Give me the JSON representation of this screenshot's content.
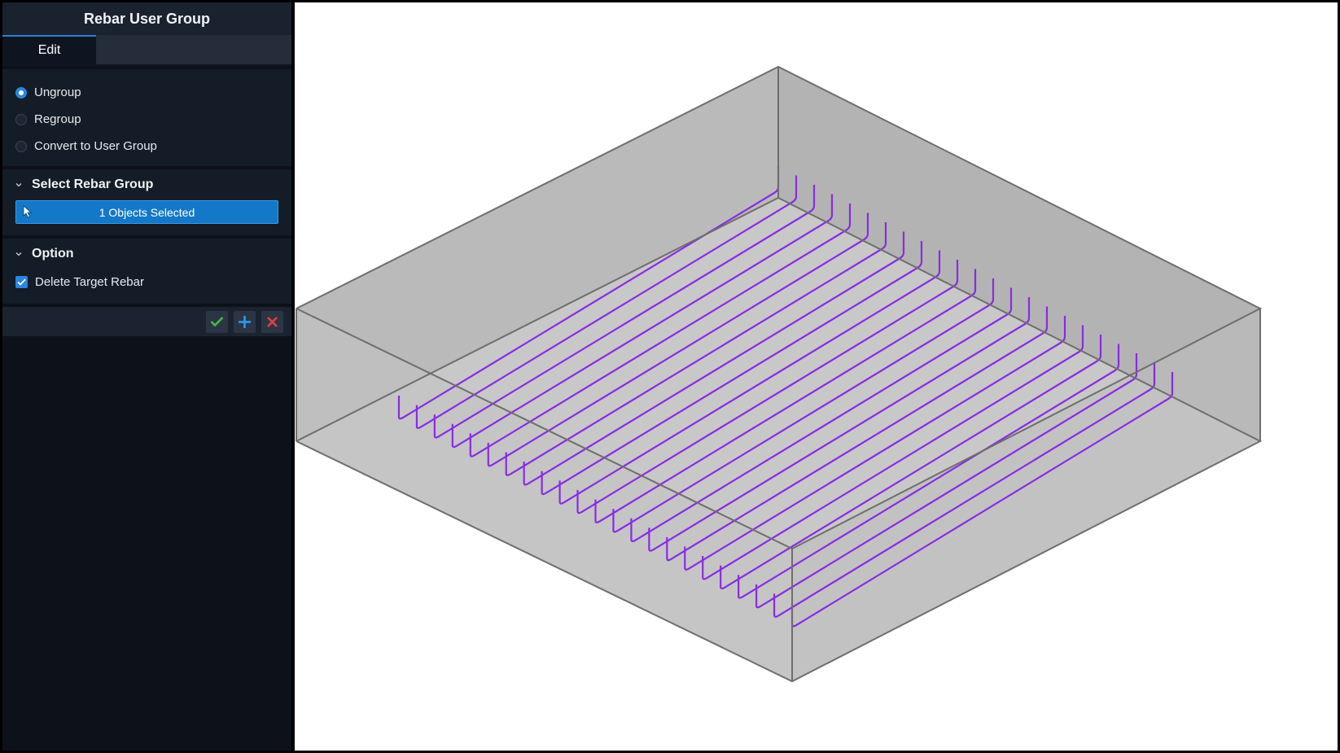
{
  "panel": {
    "title": "Rebar User Group",
    "tabs": [
      {
        "label": "Edit"
      }
    ],
    "mode_options": [
      {
        "label": "Ungroup",
        "selected": true
      },
      {
        "label": "Regroup",
        "selected": false
      },
      {
        "label": "Convert to User Group",
        "selected": false
      }
    ],
    "select_section": {
      "title": "Select Rebar Group",
      "selection_label": "1 Objects Selected"
    },
    "option_section": {
      "title": "Option",
      "delete_target_rebar": {
        "label": "Delete Target Rebar",
        "checked": true
      }
    },
    "actions": {
      "confirm": "check-icon",
      "add": "plus-icon",
      "cancel": "close-icon"
    }
  },
  "viewport": {
    "rebar_count": 23,
    "colors": {
      "rebar": "#8a2be2",
      "slab_face": "#c2c2c2",
      "slab_edge": "#777777",
      "accent": "#2b86e0",
      "confirm": "#3fbf3f",
      "cancel": "#e04040"
    }
  }
}
